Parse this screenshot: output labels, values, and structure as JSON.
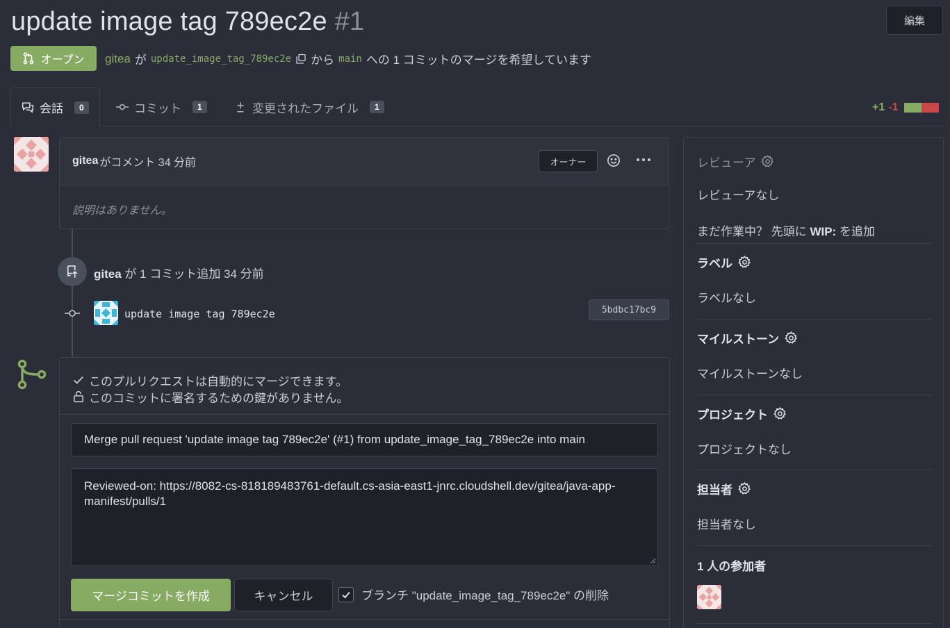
{
  "header": {
    "title": "update image tag 789ec2e",
    "number": "#1",
    "edit_label": "編集",
    "status": "オープン",
    "author": "gitea",
    "particle_ga": "が",
    "head_branch": "update_image_tag_789ec2e",
    "from_text": "から",
    "base_branch": "main",
    "summary_text": "への 1 コミットのマージを希望しています"
  },
  "tabs": [
    {
      "label": "会話",
      "count": "0"
    },
    {
      "label": "コミット",
      "count": "1"
    },
    {
      "label": "変更されたファイル",
      "count": "1"
    }
  ],
  "diffstat": {
    "additions": "+1",
    "deletions": "-1"
  },
  "comment": {
    "author": "gitea",
    "meta": "がコメント 34 分前",
    "role": "オーナー",
    "body": "説明はありません。"
  },
  "commit_event": {
    "author": "gitea",
    "meta": "が 1 コミット追加 34 分前",
    "message": "update image tag 789ec2e",
    "sha": "5bdbc17bc9"
  },
  "merge": {
    "status_mergeable": "このプルリクエストは自動的にマージできます。",
    "status_signing": "このコミットに署名するための鍵がありません。",
    "title_value": "Merge pull request 'update image tag 789ec2e' (#1) from update_image_tag_789ec2e into main",
    "message_value": "Reviewed-on: https://8082-cs-818189483761-default.cs-asia-east1-jnrc.cloudshell.dev/gitea/java-app-manifest/pulls/1",
    "submit_label": "マージコミットを作成",
    "cancel_label": "キャンセル",
    "delete_branch_label": "ブランチ \"update_image_tag_789ec2e\" の削除",
    "delete_branch_checked": true
  },
  "sidebar": {
    "reviewers_title": "レビューア",
    "reviewers_value": "レビューアなし",
    "wip_prefix": "まだ作業中？ 先頭に ",
    "wip_keyword": "WIP:",
    "wip_suffix": " を追加",
    "labels_title": "ラベル",
    "labels_value": "ラベルなし",
    "milestone_title": "マイルストーン",
    "milestone_value": "マイルストーンなし",
    "projects_title": "プロジェクト",
    "projects_value": "プロジェクトなし",
    "assignees_title": "担当者",
    "assignees_value": "担当者なし",
    "participants_title": "1 人の参加者"
  },
  "colors": {
    "background": "#2b2e38",
    "accent_green": "#87ab63",
    "deletion_red": "#cc4848",
    "avatar_pink": "#e8a3a3",
    "avatar_cyan": "#3fb6d9"
  },
  "icons": [
    "pull-request-icon",
    "copy-icon",
    "conversation-icon",
    "commit-icon",
    "diff-icon",
    "gear-icon",
    "smiley-icon",
    "kebab-icon",
    "push-icon",
    "check-icon",
    "unlock-icon",
    "merge-icon"
  ]
}
